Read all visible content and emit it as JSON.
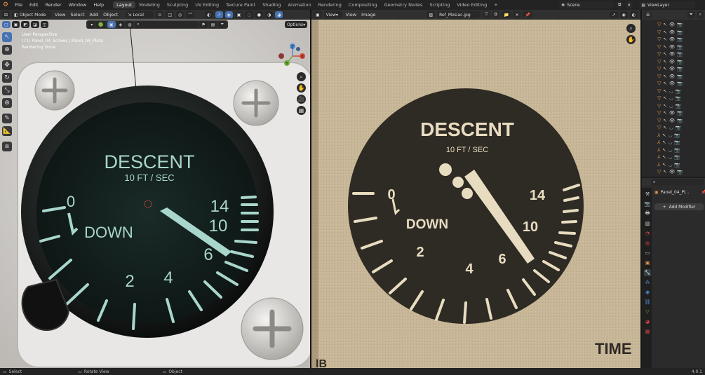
{
  "top_menu": {
    "items": [
      "File",
      "Edit",
      "Render",
      "Window",
      "Help"
    ]
  },
  "workspace_tabs": [
    "Layout",
    "Modeling",
    "Sculpting",
    "UV Editing",
    "Texture Paint",
    "Shading",
    "Animation",
    "Rendering",
    "Compositing",
    "Geometry Nodes",
    "Scripting",
    "Video Editing"
  ],
  "top_right": {
    "scene": "Scene",
    "view_layer": "ViewLayer"
  },
  "viewport": {
    "mode": "Object Mode",
    "menus": [
      "View",
      "Select",
      "Add",
      "Object"
    ],
    "transform": "Local",
    "options_label": "Options",
    "info_line1": "User Perspective",
    "info_line2": "(71) Panel_04_Screws | Panel_04_Plate",
    "info_line3": "Rendering Done",
    "gizmo_x": "X",
    "gizmo_y": "Y",
    "gizmo_z": "Z"
  },
  "gauge_model": {
    "title": "DESCENT",
    "unit": "10 FT / SEC",
    "zero": "0",
    "down": "DOWN",
    "n2": "2",
    "n4": "4",
    "n6": "6",
    "n10": "10",
    "n14": "14"
  },
  "image_editor": {
    "menus": [
      "View",
      "View",
      "Image"
    ],
    "image_name": "Ref_Mosiac.jpg",
    "gauge_title": "DESCENT",
    "gauge_unit": "10 FT / SEC",
    "zero": "0",
    "down": "DOWN",
    "n2": "2",
    "n4": "4",
    "n6": "6",
    "n10": "10",
    "n14": "14",
    "time_label": "TIME",
    "corner_label": "lB"
  },
  "properties": {
    "object_name": "Panel_04_Pl...",
    "add_modifier": "Add Modifier"
  },
  "statusbar": {
    "select": "Select",
    "rotate": "Rotate View",
    "object": "Object",
    "version": "4.0.1"
  },
  "colors": {
    "accent": "#4772b3",
    "header": "#303030",
    "panel": "#2b2b2b",
    "gauge_face": "#152421",
    "gauge_text": "#a8d6cc",
    "photo_bg": "#c7b697",
    "photo_face": "#2e2a24",
    "photo_text": "#e8dcc0"
  }
}
